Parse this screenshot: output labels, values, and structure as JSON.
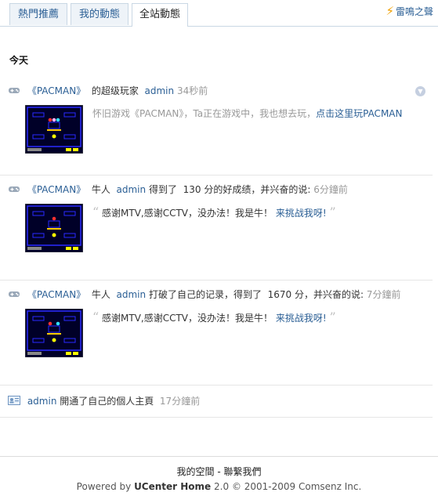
{
  "tabs": [
    {
      "label": "熱門推薦"
    },
    {
      "label": "我的動態"
    },
    {
      "label": "全站動態"
    }
  ],
  "notice": {
    "label": "雷鳴之聲"
  },
  "day_label": "今天",
  "feed": [
    {
      "game": "《PACMAN》",
      "action": "的超级玩家",
      "user": "admin",
      "time": "34秒前",
      "body_text": "怀旧游戏《PACMAN》，Ta正在游戏中，我也想去玩，",
      "body_link": "点击这里玩PACMAN"
    },
    {
      "game": "《PACMAN》",
      "role": "牛人",
      "user": "admin",
      "verb": "得到了",
      "score": "130",
      "unit_text": "分的好成绩，并兴奋的说:",
      "time": "6分鐘前",
      "quote_text": "感谢MTV,感谢CCTV，没办法！我是牛！",
      "quote_link": "来挑战我呀!"
    },
    {
      "game": "《PACMAN》",
      "role": "牛人",
      "user": "admin",
      "verb": "打破了自己的记录，得到了",
      "score": "1670",
      "unit_text": "分，并兴奋的说:",
      "time": "7分鐘前",
      "quote_text": "感谢MTV,感谢CCTV，没办法！我是牛！",
      "quote_link": "来挑战我呀!"
    },
    {
      "user": "admin",
      "action": "開通了自己的個人主頁",
      "time": "17分鐘前"
    }
  ],
  "footer": {
    "link_space": "我的空間",
    "separator": "-",
    "link_contact": "聯繫我們",
    "powered_prefix": "Powered by",
    "product": "UCenter Home",
    "version": "2.0",
    "copyright": "© 2001-2009 Comsenz Inc."
  }
}
